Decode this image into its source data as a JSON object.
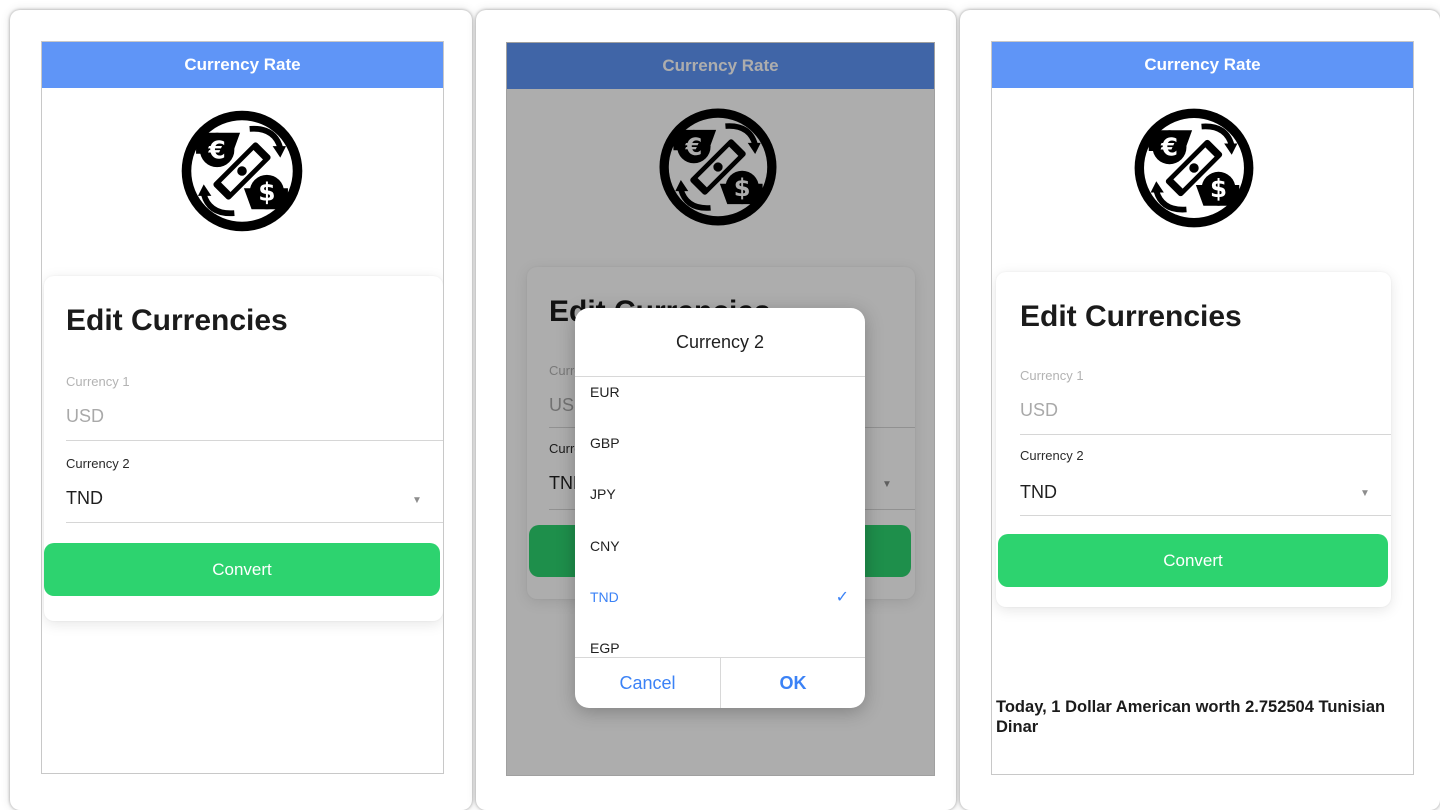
{
  "app": {
    "title": "Currency Rate"
  },
  "form": {
    "heading": "Edit Currencies",
    "currency1": {
      "label": "Currency 1",
      "value": "USD"
    },
    "currency2": {
      "label": "Currency 2",
      "value": "TND"
    },
    "convert_label": "Convert"
  },
  "picker": {
    "title": "Currency 2",
    "options": [
      "EUR",
      "GBP",
      "JPY",
      "CNY",
      "TND",
      "EGP"
    ],
    "selected": "TND",
    "cancel_label": "Cancel",
    "ok_label": "OK"
  },
  "result": {
    "text": "Today, 1 Dollar American worth 2.752504 Tunisian Dinar"
  },
  "colors": {
    "appbar": "#5f95f7",
    "convert": "#2dd36f",
    "accent": "#3b82f6"
  },
  "icons": {
    "logo": "currency-exchange-icon",
    "picker_caret": "caret-down-icon",
    "selected_check": "checkmark-icon"
  }
}
